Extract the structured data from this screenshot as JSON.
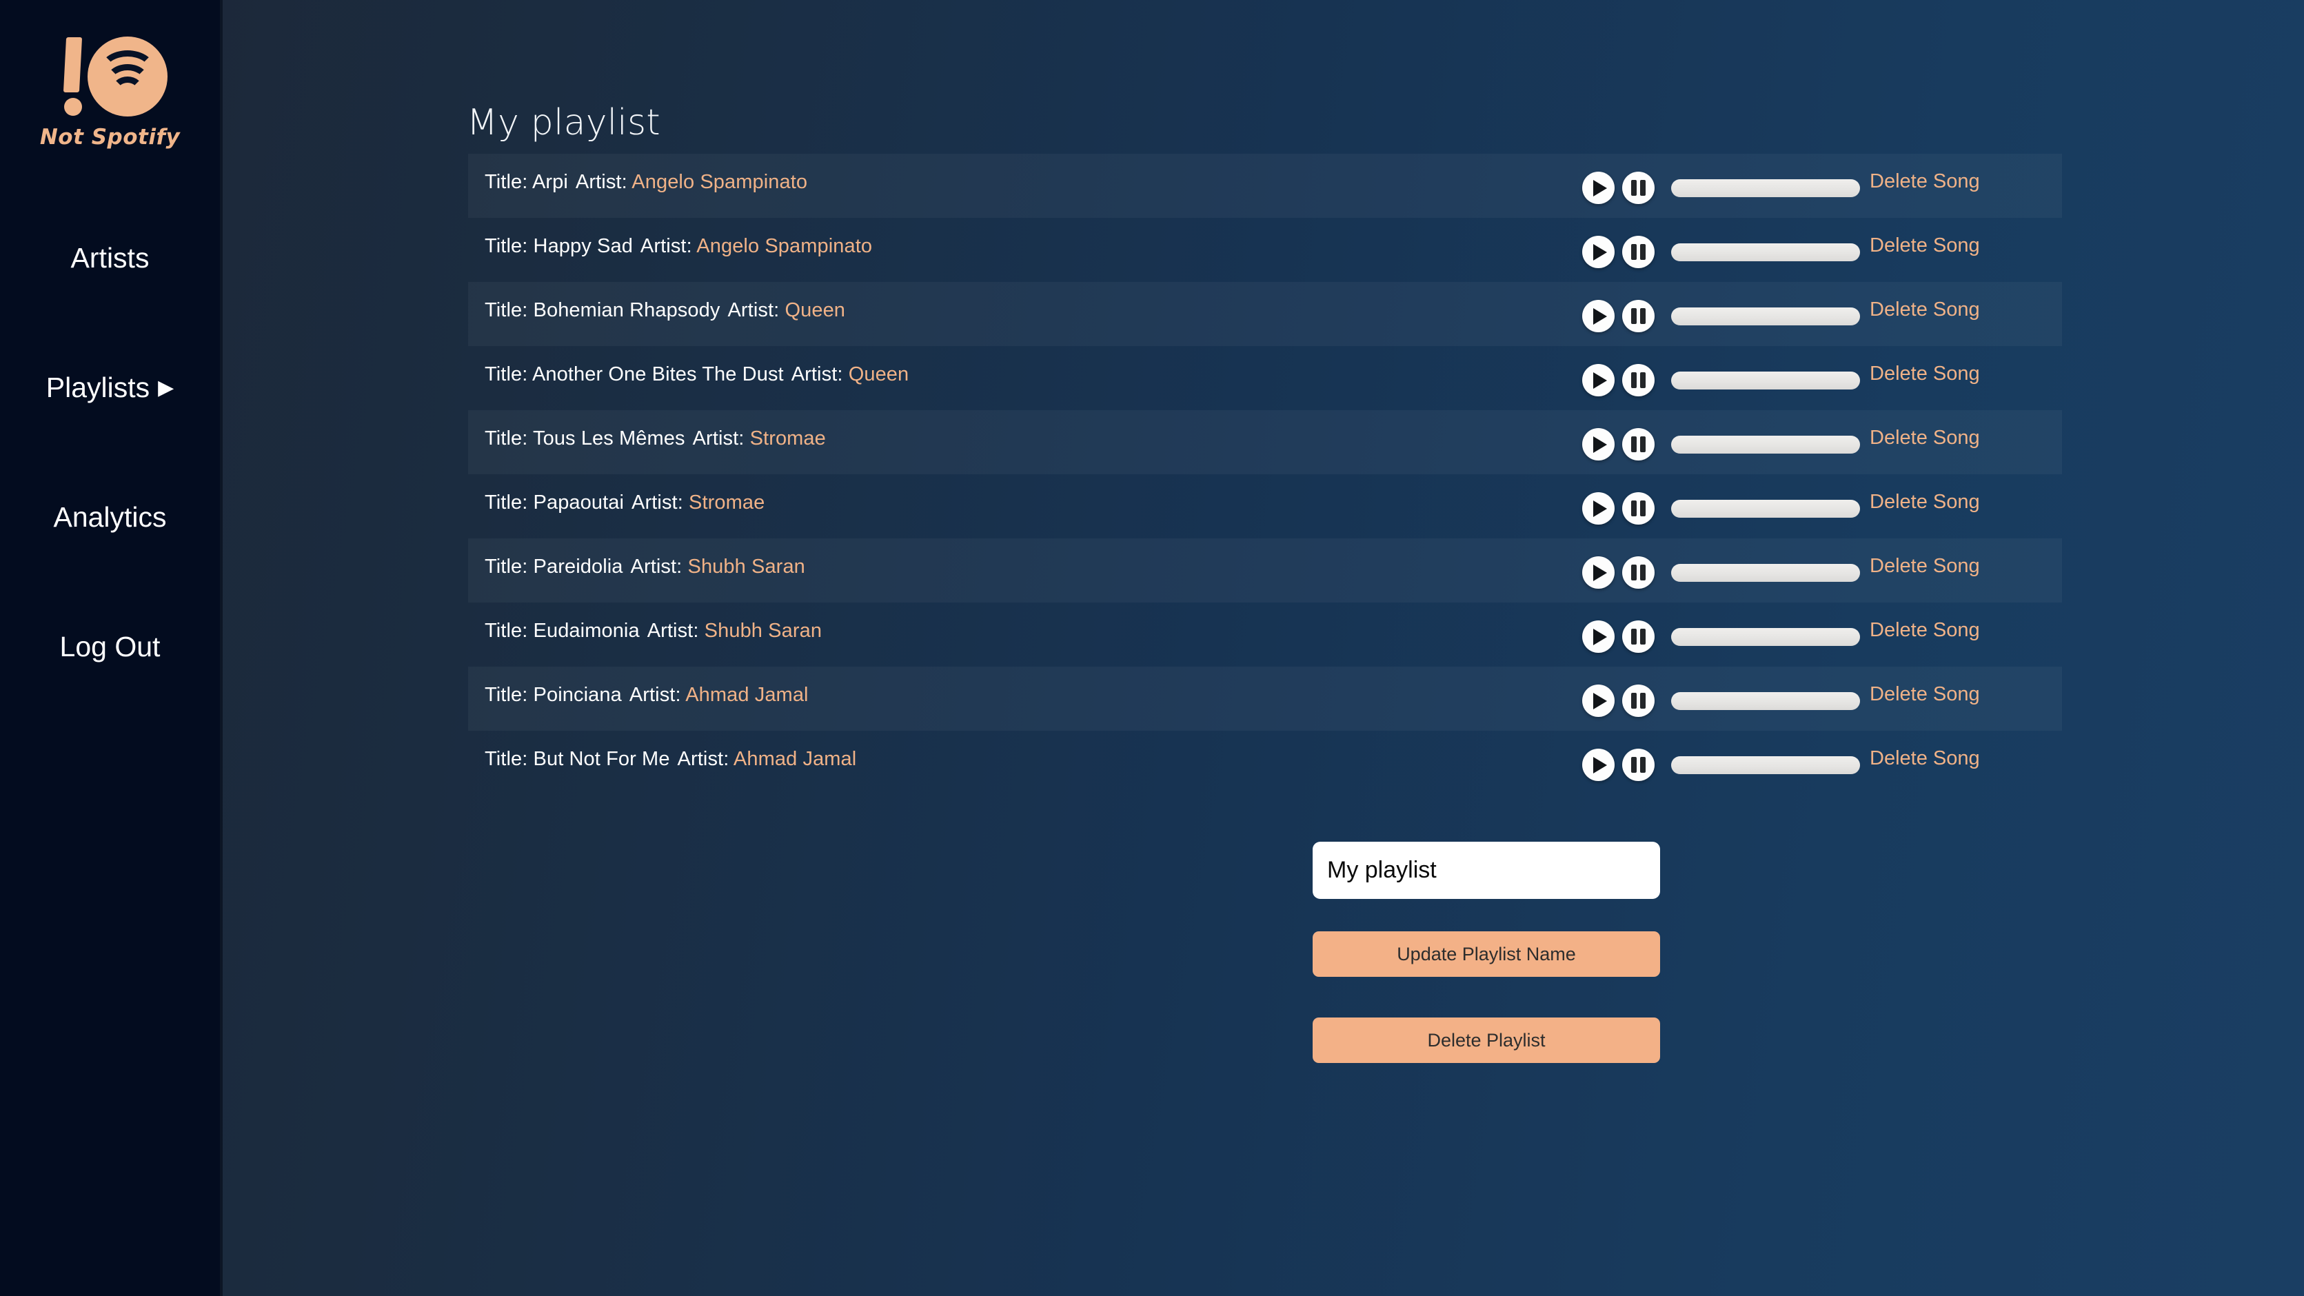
{
  "brand": {
    "logo_icon": "not-spotify-logo-icon",
    "name": "Not Spotify"
  },
  "sidebar": {
    "items": [
      {
        "label": "Artists",
        "icon": null,
        "has_caret": false
      },
      {
        "label": "Playlists",
        "icon": "chevron-right-icon",
        "has_caret": true,
        "caret": "▶"
      },
      {
        "label": "Analytics",
        "icon": null,
        "has_caret": false
      },
      {
        "label": "Log Out",
        "icon": null,
        "has_caret": false
      }
    ]
  },
  "main": {
    "page_title": "My playlist",
    "labels": {
      "title_prefix": "Title:",
      "artist_prefix": "Artist:",
      "delete_song": "Delete Song"
    },
    "controls": {
      "play_icon": "play-icon",
      "pause_icon": "pause-icon",
      "progress_value": 0
    },
    "songs": [
      {
        "title": "Arpi",
        "artist": "Angelo Spampinato"
      },
      {
        "title": "Happy Sad",
        "artist": "Angelo Spampinato"
      },
      {
        "title": "Bohemian Rhapsody",
        "artist": "Queen"
      },
      {
        "title": "Another One Bites The Dust",
        "artist": "Queen"
      },
      {
        "title": "Tous Les Mêmes",
        "artist": "Stromae"
      },
      {
        "title": "Papaoutai",
        "artist": "Stromae"
      },
      {
        "title": "Pareidolia",
        "artist": "Shubh Saran"
      },
      {
        "title": "Eudaimonia",
        "artist": "Shubh Saran"
      },
      {
        "title": "Poinciana",
        "artist": "Ahmad Jamal"
      },
      {
        "title": "But Not For Me",
        "artist": "Ahmad Jamal"
      }
    ]
  },
  "form": {
    "playlist_name_value": "My playlist",
    "playlist_name_placeholder": "Playlist name",
    "update_button": "Update Playlist Name",
    "delete_button": "Delete Playlist"
  },
  "colors": {
    "accent": "#f0b287",
    "sidebar_bg": "#030c1f",
    "page_bg_left": "#1c2636",
    "page_bg_right": "#1a3e63",
    "button_bg": "#f3b187",
    "row_shade": "rgba(255,255,255,0.045)"
  }
}
